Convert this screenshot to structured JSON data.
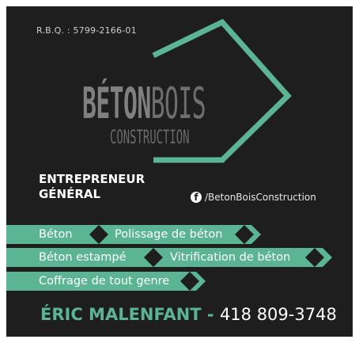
{
  "rbq": "R.B.Q. : 5799-2166-01",
  "logo": {
    "part1": "BÉTON",
    "part2": "BOIS",
    "subtitle": "CONSTRUCTION"
  },
  "title": {
    "line1": "ENTREPRENEUR",
    "line2": "GÉNÉRAL"
  },
  "facebook": {
    "icon": "facebook-icon",
    "handle": "/BetonBoisConstruction"
  },
  "services": [
    "Béton",
    "Polissage de béton",
    "Béton estampé",
    "Vitrification de béton",
    "Coffrage de tout genre"
  ],
  "contact": {
    "name": "ÉRIC MALENFANT",
    "separator": " - ",
    "phone": "418 809-3748"
  },
  "colors": {
    "accent": "#5bb595",
    "background": "#1e1e1e",
    "logo_gray": "#777777"
  }
}
